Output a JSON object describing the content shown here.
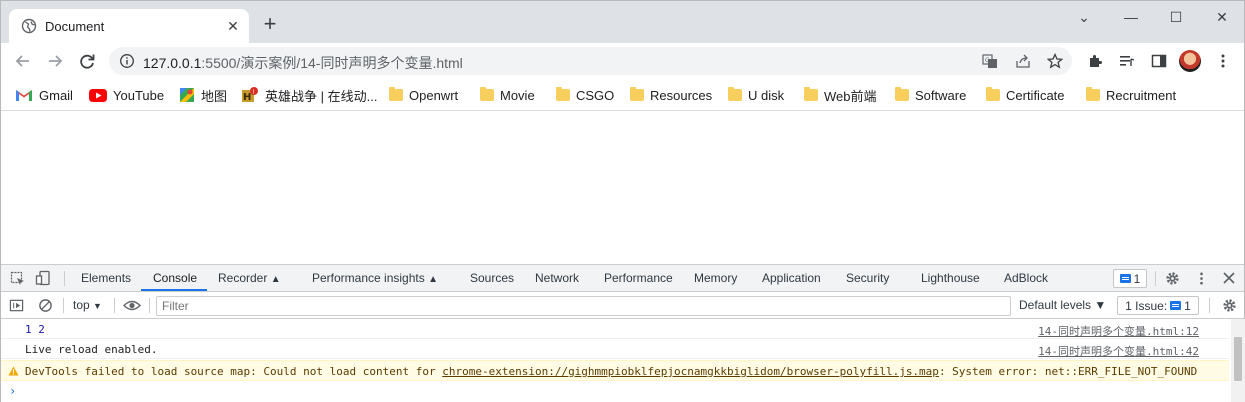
{
  "tab": {
    "title": "Document",
    "close": "✕",
    "newtab": "+"
  },
  "window_controls": {
    "dropdown": "⌄",
    "minimize": "—",
    "maximize": "☐",
    "close": "✕"
  },
  "omnibox": {
    "url_host": "127.0.0.1",
    "url_rest": ":5500/演示案例/14-同时声明多个变量.html"
  },
  "bookmarks": [
    {
      "label": "Gmail"
    },
    {
      "label": "YouTube"
    },
    {
      "label": "地图"
    },
    {
      "label": "英雄战争 | 在线动..."
    },
    {
      "label": "Openwrt"
    },
    {
      "label": "Movie"
    },
    {
      "label": "CSGO"
    },
    {
      "label": "Resources"
    },
    {
      "label": "U disk"
    },
    {
      "label": "Web前端"
    },
    {
      "label": "Software"
    },
    {
      "label": "Certificate"
    },
    {
      "label": "Recruitment"
    }
  ],
  "devtools": {
    "tabs": [
      "Elements",
      "Console",
      "Recorder",
      "Performance insights",
      "Sources",
      "Network",
      "Performance",
      "Memory",
      "Application",
      "Security",
      "Lighthouse",
      "AdBlock"
    ],
    "active_tab": "Console",
    "message_count": "1",
    "context": "top",
    "filter_placeholder": "Filter",
    "levels": "Default levels ▼",
    "issues_label": "1 Issue:",
    "issues_count": "1",
    "console_lines": [
      {
        "text": "1 2",
        "source": "14-同时声明多个变量.html:12",
        "color": "#1a1aa6"
      },
      {
        "text": "Live reload enabled.",
        "source": "14-同时声明多个变量.html:42",
        "color": "#202124"
      }
    ],
    "warning": {
      "prefix": "DevTools failed to load source map: Could not load content for ",
      "link": "chrome-extension://gighmmpiobklfepjocnamgkkbiglidom/browser-polyfill.js.map",
      "suffix": ": System error: net::ERR_FILE_NOT_FOUND"
    },
    "prompt": "›"
  },
  "colors": {
    "accent": "#1a73e8",
    "warning_bg": "#fffbe5",
    "tabstrip": "#dee1e6"
  }
}
